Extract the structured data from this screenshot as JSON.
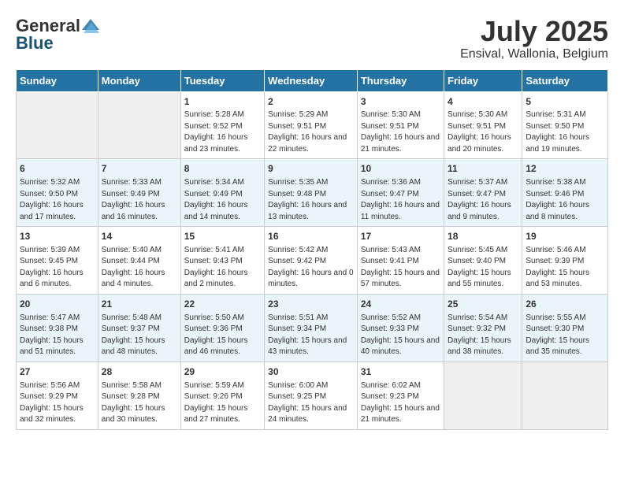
{
  "header": {
    "logo_general": "General",
    "logo_blue": "Blue",
    "title": "July 2025",
    "subtitle": "Ensival, Wallonia, Belgium"
  },
  "weekdays": [
    "Sunday",
    "Monday",
    "Tuesday",
    "Wednesday",
    "Thursday",
    "Friday",
    "Saturday"
  ],
  "weeks": [
    [
      {
        "day": "",
        "sunrise": "",
        "sunset": "",
        "daylight": ""
      },
      {
        "day": "",
        "sunrise": "",
        "sunset": "",
        "daylight": ""
      },
      {
        "day": "1",
        "sunrise": "Sunrise: 5:28 AM",
        "sunset": "Sunset: 9:52 PM",
        "daylight": "Daylight: 16 hours and 23 minutes."
      },
      {
        "day": "2",
        "sunrise": "Sunrise: 5:29 AM",
        "sunset": "Sunset: 9:51 PM",
        "daylight": "Daylight: 16 hours and 22 minutes."
      },
      {
        "day": "3",
        "sunrise": "Sunrise: 5:30 AM",
        "sunset": "Sunset: 9:51 PM",
        "daylight": "Daylight: 16 hours and 21 minutes."
      },
      {
        "day": "4",
        "sunrise": "Sunrise: 5:30 AM",
        "sunset": "Sunset: 9:51 PM",
        "daylight": "Daylight: 16 hours and 20 minutes."
      },
      {
        "day": "5",
        "sunrise": "Sunrise: 5:31 AM",
        "sunset": "Sunset: 9:50 PM",
        "daylight": "Daylight: 16 hours and 19 minutes."
      }
    ],
    [
      {
        "day": "6",
        "sunrise": "Sunrise: 5:32 AM",
        "sunset": "Sunset: 9:50 PM",
        "daylight": "Daylight: 16 hours and 17 minutes."
      },
      {
        "day": "7",
        "sunrise": "Sunrise: 5:33 AM",
        "sunset": "Sunset: 9:49 PM",
        "daylight": "Daylight: 16 hours and 16 minutes."
      },
      {
        "day": "8",
        "sunrise": "Sunrise: 5:34 AM",
        "sunset": "Sunset: 9:49 PM",
        "daylight": "Daylight: 16 hours and 14 minutes."
      },
      {
        "day": "9",
        "sunrise": "Sunrise: 5:35 AM",
        "sunset": "Sunset: 9:48 PM",
        "daylight": "Daylight: 16 hours and 13 minutes."
      },
      {
        "day": "10",
        "sunrise": "Sunrise: 5:36 AM",
        "sunset": "Sunset: 9:47 PM",
        "daylight": "Daylight: 16 hours and 11 minutes."
      },
      {
        "day": "11",
        "sunrise": "Sunrise: 5:37 AM",
        "sunset": "Sunset: 9:47 PM",
        "daylight": "Daylight: 16 hours and 9 minutes."
      },
      {
        "day": "12",
        "sunrise": "Sunrise: 5:38 AM",
        "sunset": "Sunset: 9:46 PM",
        "daylight": "Daylight: 16 hours and 8 minutes."
      }
    ],
    [
      {
        "day": "13",
        "sunrise": "Sunrise: 5:39 AM",
        "sunset": "Sunset: 9:45 PM",
        "daylight": "Daylight: 16 hours and 6 minutes."
      },
      {
        "day": "14",
        "sunrise": "Sunrise: 5:40 AM",
        "sunset": "Sunset: 9:44 PM",
        "daylight": "Daylight: 16 hours and 4 minutes."
      },
      {
        "day": "15",
        "sunrise": "Sunrise: 5:41 AM",
        "sunset": "Sunset: 9:43 PM",
        "daylight": "Daylight: 16 hours and 2 minutes."
      },
      {
        "day": "16",
        "sunrise": "Sunrise: 5:42 AM",
        "sunset": "Sunset: 9:42 PM",
        "daylight": "Daylight: 16 hours and 0 minutes."
      },
      {
        "day": "17",
        "sunrise": "Sunrise: 5:43 AM",
        "sunset": "Sunset: 9:41 PM",
        "daylight": "Daylight: 15 hours and 57 minutes."
      },
      {
        "day": "18",
        "sunrise": "Sunrise: 5:45 AM",
        "sunset": "Sunset: 9:40 PM",
        "daylight": "Daylight: 15 hours and 55 minutes."
      },
      {
        "day": "19",
        "sunrise": "Sunrise: 5:46 AM",
        "sunset": "Sunset: 9:39 PM",
        "daylight": "Daylight: 15 hours and 53 minutes."
      }
    ],
    [
      {
        "day": "20",
        "sunrise": "Sunrise: 5:47 AM",
        "sunset": "Sunset: 9:38 PM",
        "daylight": "Daylight: 15 hours and 51 minutes."
      },
      {
        "day": "21",
        "sunrise": "Sunrise: 5:48 AM",
        "sunset": "Sunset: 9:37 PM",
        "daylight": "Daylight: 15 hours and 48 minutes."
      },
      {
        "day": "22",
        "sunrise": "Sunrise: 5:50 AM",
        "sunset": "Sunset: 9:36 PM",
        "daylight": "Daylight: 15 hours and 46 minutes."
      },
      {
        "day": "23",
        "sunrise": "Sunrise: 5:51 AM",
        "sunset": "Sunset: 9:34 PM",
        "daylight": "Daylight: 15 hours and 43 minutes."
      },
      {
        "day": "24",
        "sunrise": "Sunrise: 5:52 AM",
        "sunset": "Sunset: 9:33 PM",
        "daylight": "Daylight: 15 hours and 40 minutes."
      },
      {
        "day": "25",
        "sunrise": "Sunrise: 5:54 AM",
        "sunset": "Sunset: 9:32 PM",
        "daylight": "Daylight: 15 hours and 38 minutes."
      },
      {
        "day": "26",
        "sunrise": "Sunrise: 5:55 AM",
        "sunset": "Sunset: 9:30 PM",
        "daylight": "Daylight: 15 hours and 35 minutes."
      }
    ],
    [
      {
        "day": "27",
        "sunrise": "Sunrise: 5:56 AM",
        "sunset": "Sunset: 9:29 PM",
        "daylight": "Daylight: 15 hours and 32 minutes."
      },
      {
        "day": "28",
        "sunrise": "Sunrise: 5:58 AM",
        "sunset": "Sunset: 9:28 PM",
        "daylight": "Daylight: 15 hours and 30 minutes."
      },
      {
        "day": "29",
        "sunrise": "Sunrise: 5:59 AM",
        "sunset": "Sunset: 9:26 PM",
        "daylight": "Daylight: 15 hours and 27 minutes."
      },
      {
        "day": "30",
        "sunrise": "Sunrise: 6:00 AM",
        "sunset": "Sunset: 9:25 PM",
        "daylight": "Daylight: 15 hours and 24 minutes."
      },
      {
        "day": "31",
        "sunrise": "Sunrise: 6:02 AM",
        "sunset": "Sunset: 9:23 PM",
        "daylight": "Daylight: 15 hours and 21 minutes."
      },
      {
        "day": "",
        "sunrise": "",
        "sunset": "",
        "daylight": ""
      },
      {
        "day": "",
        "sunrise": "",
        "sunset": "",
        "daylight": ""
      }
    ]
  ]
}
